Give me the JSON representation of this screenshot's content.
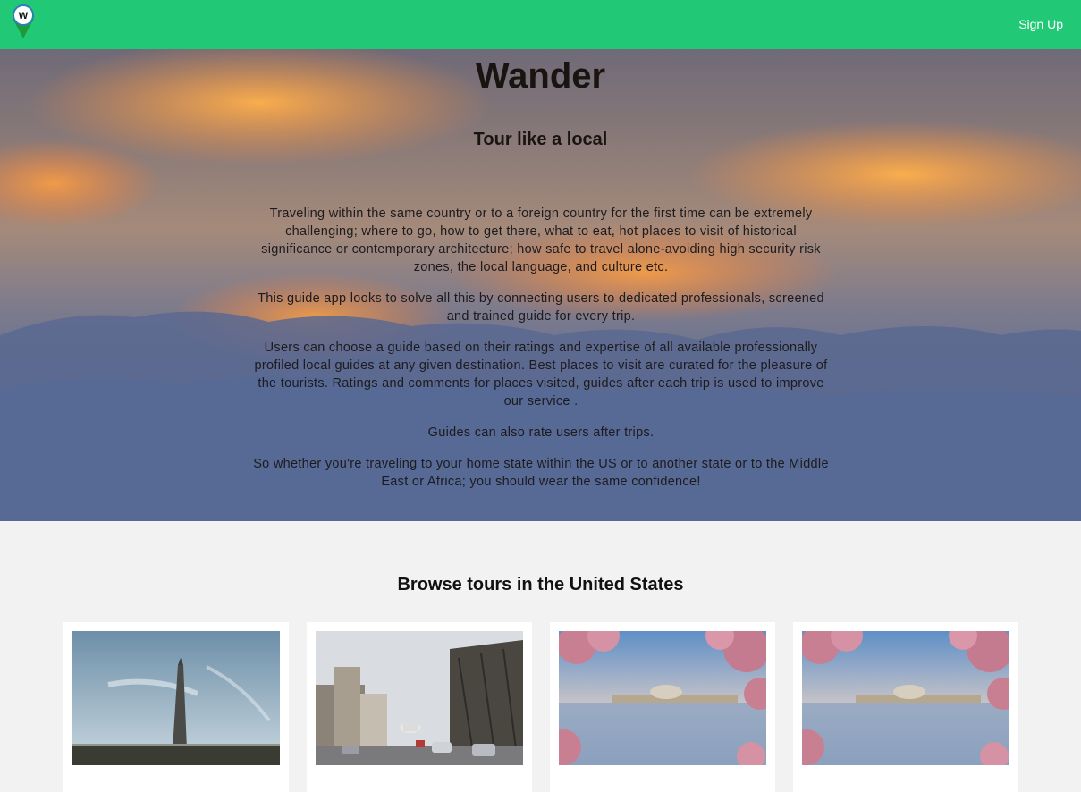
{
  "nav": {
    "logo_letter": "W",
    "signup_label": "Sign Up",
    "brand_color": "#21c875"
  },
  "hero": {
    "title": "Wander",
    "subtitle": "Tour like a local",
    "paragraphs": [
      "Traveling within the same country or to a foreign country for the first time can be extremely challenging; where to go, how to get there, what to eat, hot places to visit of historical significance or contemporary architecture; how safe to travel alone-avoiding high security risk zones, the local language, and culture etc.",
      "This guide app looks to solve all this by connecting users to dedicated professionals, screened and trained guide for every trip.",
      "Users can choose a guide based on their ratings and expertise of all available professionally profiled local guides at any given destination. Best places to visit are curated for the pleasure of the tourists. Ratings and comments for places visited, guides after each trip is used to improve our service .",
      "Guides can also rate users after trips.",
      "So whether you're traveling to your home state within the US or to another state or to the Middle East or Africa; you should wear the same confidence!"
    ]
  },
  "browse": {
    "title": "Browse tours in the United States",
    "cards": [
      {
        "image": "washington-monument-photo"
      },
      {
        "image": "capitol-street-photo"
      },
      {
        "image": "cherry-blossom-memorial-photo"
      },
      {
        "image": "cherry-blossom-memorial-photo"
      }
    ]
  }
}
